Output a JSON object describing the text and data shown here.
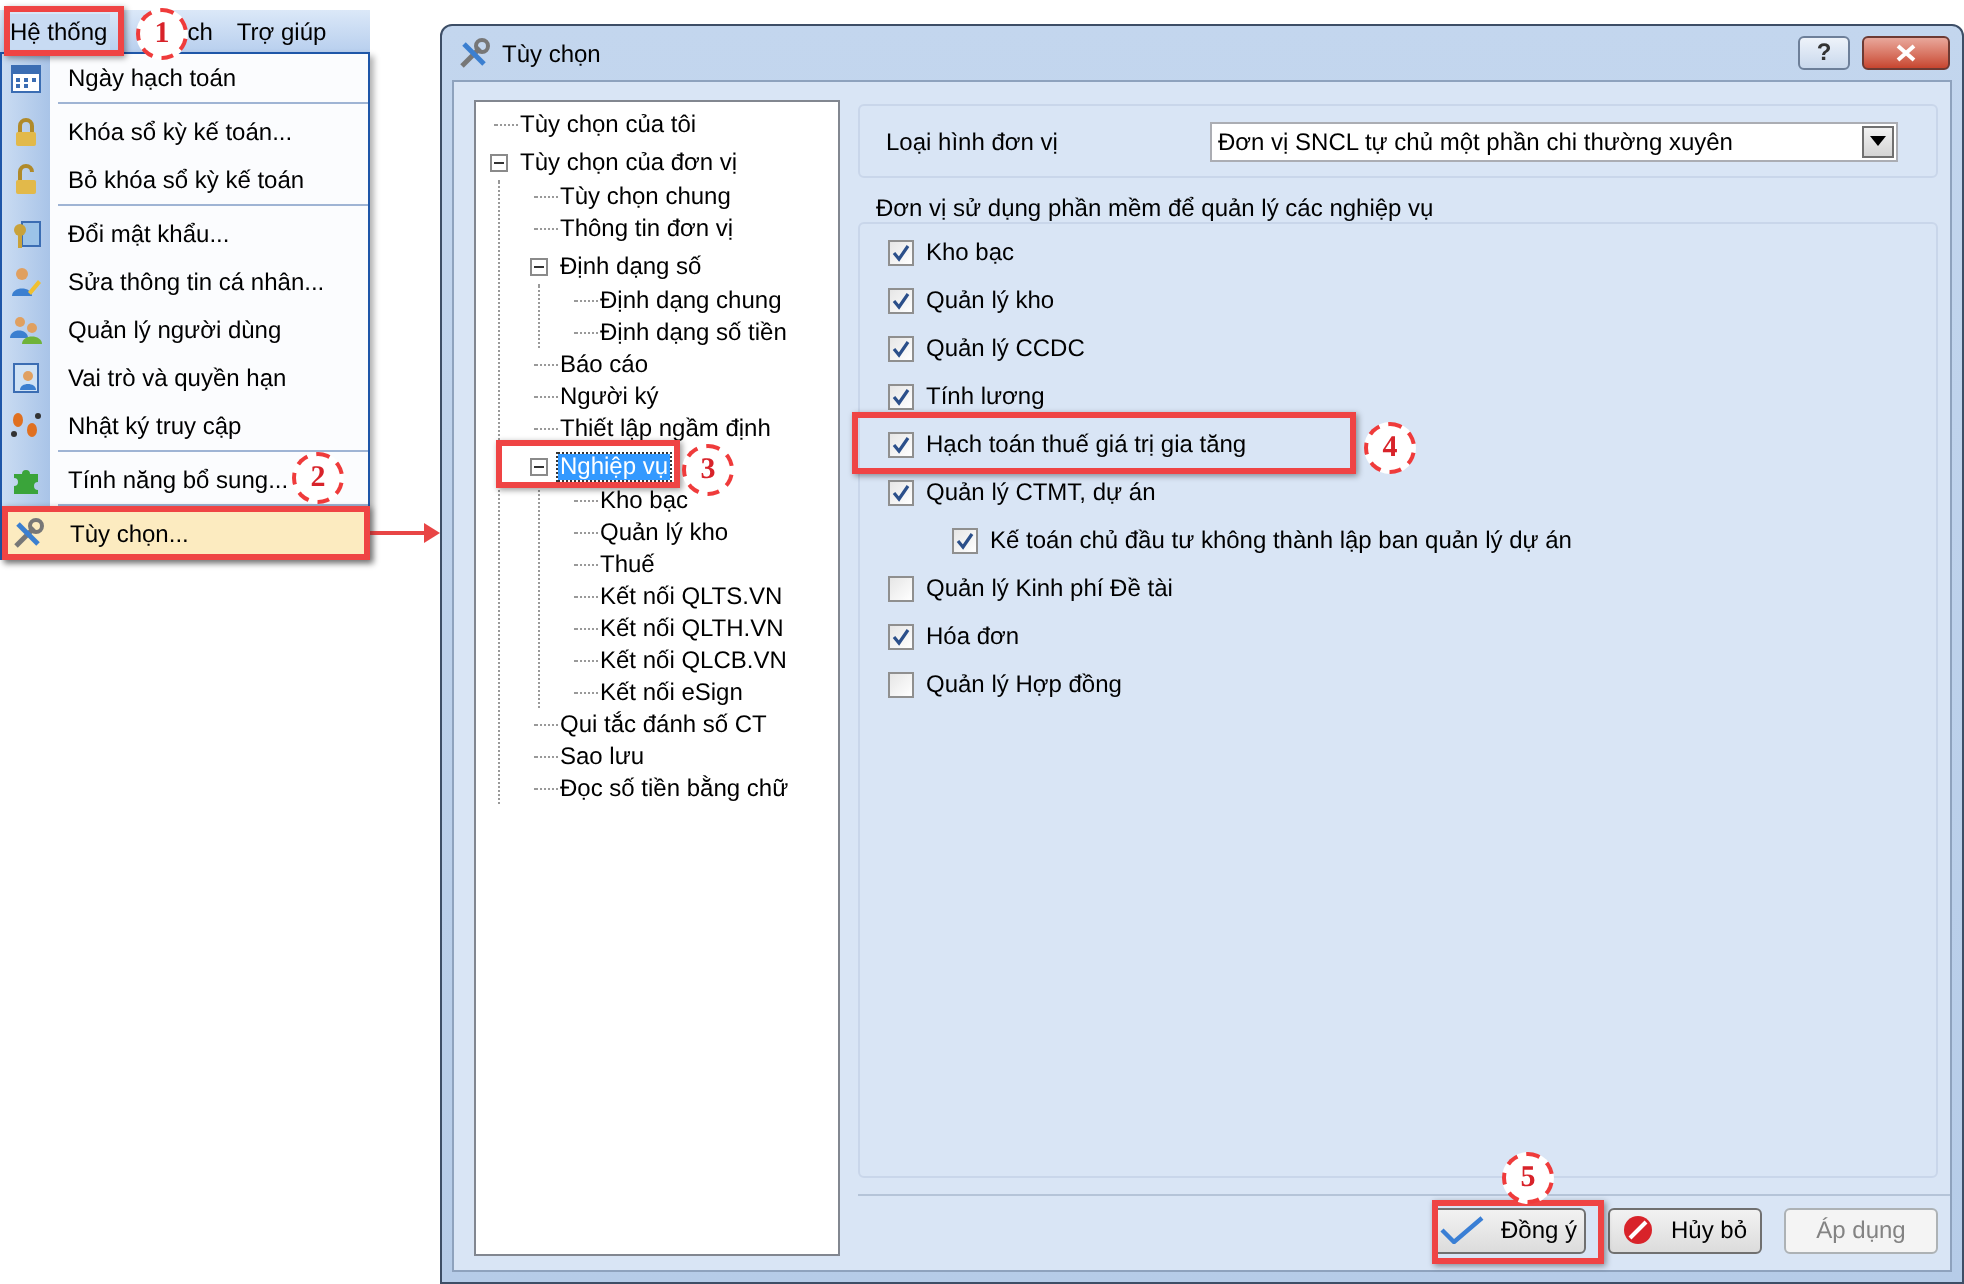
{
  "menubar": [
    {
      "label": "Hệ thống",
      "selected": true
    },
    {
      "label": "ch",
      "selected": false
    },
    {
      "label": "Trợ giúp",
      "selected": false
    }
  ],
  "menu": {
    "groups": [
      [
        {
          "label": "Ngày hạch toán",
          "selected": false
        }
      ],
      [
        {
          "label": "Khóa sổ kỳ kế toán...",
          "selected": false
        },
        {
          "label": "Bỏ khóa sổ kỳ kế toán",
          "selected": false
        }
      ],
      [
        {
          "label": "Đổi mật khẩu...",
          "selected": false
        },
        {
          "label": "Sửa thông tin cá nhân...",
          "selected": false
        },
        {
          "label": "Quản lý người dùng",
          "selected": false
        },
        {
          "label": "Vai trò và quyền hạn",
          "selected": false
        },
        {
          "label": "Nhật ký truy cập",
          "selected": false
        }
      ],
      [
        {
          "label": "Tính năng bổ sung...",
          "selected": false
        }
      ],
      [
        {
          "label": "Tùy chọn...",
          "selected": true
        }
      ]
    ]
  },
  "dialog": {
    "title": "Tùy chọn",
    "help_button": "?",
    "tree": [
      {
        "label": "Tùy chọn của tôi",
        "selected": false
      },
      {
        "label": "Tùy chọn của đơn vị",
        "selected": false,
        "expanded": true,
        "children": [
          {
            "label": "Tùy chọn chung",
            "selected": false
          },
          {
            "label": "Thông tin đơn vị",
            "selected": false
          },
          {
            "label": "Định dạng số",
            "selected": false,
            "expanded": true,
            "children": [
              {
                "label": "Định dạng chung",
                "selected": false
              },
              {
                "label": "Định dạng số tiền",
                "selected": false
              }
            ]
          },
          {
            "label": "Báo cáo",
            "selected": false
          },
          {
            "label": "Người ký",
            "selected": false
          },
          {
            "label": "Thiết lập ngầm định",
            "selected": false
          },
          {
            "label": "Nghiệp vụ",
            "selected": true,
            "expanded": true,
            "children": [
              {
                "label": "Kho bạc",
                "selected": false
              },
              {
                "label": "Quản lý kho",
                "selected": false
              },
              {
                "label": "Thuế",
                "selected": false
              },
              {
                "label": "Kết nối QLTS.VN",
                "selected": false
              },
              {
                "label": "Kết nối QLTH.VN",
                "selected": false
              },
              {
                "label": "Kết nối QLCB.VN",
                "selected": false
              },
              {
                "label": "Kết nối eSign",
                "selected": false
              }
            ]
          },
          {
            "label": "Qui tắc đánh số CT",
            "selected": false
          },
          {
            "label": "Sao lưu",
            "selected": false
          },
          {
            "label": "Đọc số tiền bằng chữ",
            "selected": false
          }
        ]
      }
    ],
    "unit_type": {
      "label": "Loại hình đơn vị",
      "value": "Đơn vị SNCL tự chủ một phần chi thường xuyên"
    },
    "modules": {
      "title": "Đơn vị sử dụng phần mềm để quản lý các nghiệp vụ",
      "options": [
        {
          "label": "Kho bạc",
          "checked": true
        },
        {
          "label": "Quản lý kho",
          "checked": true
        },
        {
          "label": "Quản lý CCDC",
          "checked": true
        },
        {
          "label": "Tính lương",
          "checked": true
        },
        {
          "label": "Hạch toán thuế giá trị gia tăng",
          "checked": true
        },
        {
          "label": "Quản lý CTMT, dự án",
          "checked": true,
          "children": [
            {
              "label": "Kế toán chủ đầu tư không thành lập ban quản lý dự án",
              "checked": true
            }
          ]
        },
        {
          "label": "Quản lý Kinh phí Đề tài",
          "checked": false
        },
        {
          "label": "Hóa đơn",
          "checked": true
        },
        {
          "label": "Quản lý Hợp đồng",
          "checked": false
        }
      ]
    },
    "buttons": [
      {
        "label": "Đồng ý",
        "kind": "ok",
        "disabled": false
      },
      {
        "label": "Hủy bỏ",
        "kind": "cancel",
        "disabled": false
      },
      {
        "label": "Áp dụng",
        "kind": "apply",
        "disabled": true
      }
    ]
  },
  "callouts": [
    "1",
    "2",
    "3",
    "4",
    "5"
  ]
}
